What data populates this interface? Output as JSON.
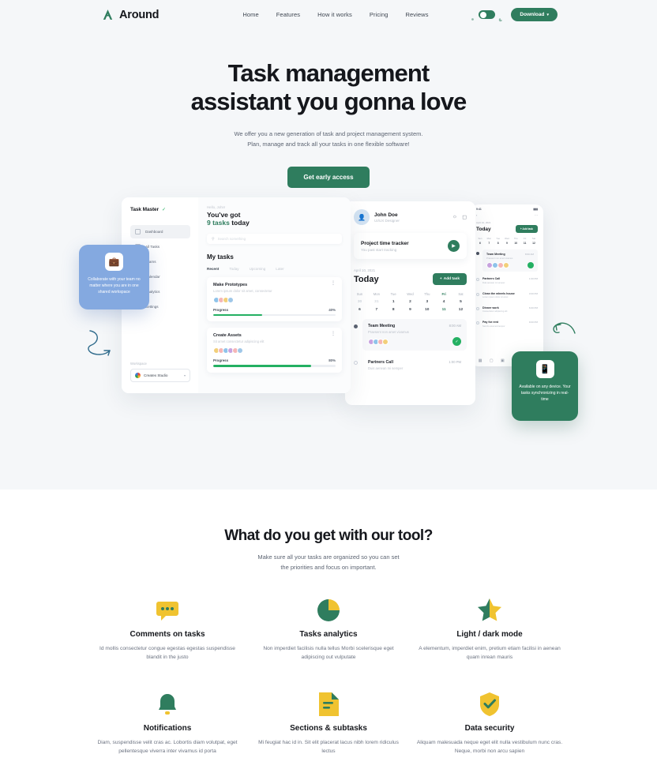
{
  "nav": {
    "logo_text": "Around",
    "links": [
      {
        "label": "Home"
      },
      {
        "label": "Features"
      },
      {
        "label": "How it works"
      },
      {
        "label": "Pricing"
      },
      {
        "label": "Reviews"
      }
    ],
    "download_label": "Download",
    "download_chevron": "▾"
  },
  "hero": {
    "title_line1_highlight": "Task management",
    "title_line2": "assistant you gonna love",
    "sub_line1": "We offer you a new generation of task and project management system.",
    "sub_line2": "Plan, manage and track all your tasks in one flexible software!",
    "cta_label": "Get early access"
  },
  "tips": {
    "blue": "Collaborate with your team no matter where you are in one shared workspace",
    "green": "Available on any device. Your tasks synchronizing in real-time"
  },
  "app": {
    "sidebar": {
      "brand": "Task Master",
      "items": [
        {
          "label": "Dashboard"
        },
        {
          "label": "All Tasks"
        },
        {
          "label": "Teams"
        },
        {
          "label": "Calendar"
        },
        {
          "label": "Analytics"
        },
        {
          "label": "Settings"
        }
      ],
      "workspace_label": "Workspace",
      "workspace_value": "Createx Studio",
      "workspace_chevron": "▾"
    },
    "main": {
      "hello": "Hello, John!",
      "headline_1": "You've got",
      "headline_count": "9 tasks",
      "headline_2": " today",
      "search_placeholder": "Search something",
      "section_title": "My tasks",
      "tabs": [
        "Recent",
        "Today",
        "Upcoming",
        "Later"
      ],
      "tasks": [
        {
          "title": "Make Prototypes",
          "desc": "Lorem ipsum dolor sit amet, consectetur",
          "progress_label": "Progress",
          "progress_value": "40%",
          "progress_pct": 40
        },
        {
          "title": "Create Assets",
          "desc": "Sit amet consectetur adipiscing elit",
          "progress_label": "Progress",
          "progress_value": "80%",
          "progress_pct": 80
        }
      ]
    },
    "detail": {
      "user_name": "John Doe",
      "user_role": "UI/UX Designer",
      "tracker_title": "Project time tracker",
      "tracker_sub": "You past start tracking",
      "date_label": "April 10, 2021",
      "today_label": "Today",
      "add_task_label": "Add task",
      "add_task_plus": "+",
      "weekdays": [
        "Sun",
        "Mon",
        "Tue",
        "Wed",
        "Thu",
        "Fri",
        "Sat"
      ],
      "active_weekday_index": 5,
      "days_row1": [
        "30",
        "31",
        "1",
        "2",
        "3",
        "4",
        "5"
      ],
      "days_row1_dim": [
        true,
        true,
        false,
        false,
        false,
        false,
        false
      ],
      "days_row2": [
        "6",
        "7",
        "8",
        "9",
        "10",
        "11",
        "12"
      ],
      "active_day": "11",
      "events": [
        {
          "title": "Team Meeting",
          "time": "8:00 AM",
          "desc": "Praesent non amet vivamus"
        },
        {
          "title": "Partners Call",
          "time": "1:00 PM",
          "desc": "Duis aenean mi semper"
        }
      ]
    },
    "phone": {
      "status_time": "9:41",
      "status_right": "▮▮▮",
      "back_icon": "‹",
      "menu_icon": "⋯",
      "date_label": "April 10, 2021",
      "today_label": "Today",
      "add_task_label": "+ Add task",
      "weekdays": [
        "Sun",
        "Mon",
        "Tue",
        "Wed",
        "Thu",
        "Fri",
        "Sat"
      ],
      "days": [
        "6",
        "7",
        "8",
        "9",
        "10",
        "11",
        "12"
      ],
      "items": [
        {
          "title": "Team Meeting",
          "time": "8:00 AM",
          "desc": "Praesent non amet vivamus"
        },
        {
          "title": "Partners Call",
          "time": "1:00 PM",
          "desc": "Duis aenean mi semper"
        },
        {
          "title": "Clean the wheels house",
          "time": "3:00 PM",
          "desc": "Lorem ipsum dolor sit amet"
        },
        {
          "title": "Dinner work",
          "time": "6:00 PM",
          "desc": "Consectetur adipiscing elit"
        },
        {
          "title": "Pay for rent",
          "time": "9:00 PM",
          "desc": "Sed do eiusmod tempor"
        }
      ]
    }
  },
  "features": {
    "title": "What do you get with our tool?",
    "sub_line1": "Make sure all your tasks are organized so you can set",
    "sub_line2": "the priorities and focus on important.",
    "items": [
      {
        "icon": "comment-bubble-icon",
        "name": "Comments on tasks",
        "desc": "Id mollis consectetur congue egestas egestas suspendisse blandit in the justo"
      },
      {
        "icon": "pie-chart-icon",
        "name": "Tasks analytics",
        "desc": "Non imperdiet facilisis nulla tellus Morbi scelerisque eget adipiscing out vulputate"
      },
      {
        "icon": "star-icon",
        "name": "Light / dark mode",
        "desc": "A elementum, imperdiet enim, pretium etiam facilisi in aenean quam inrean mauris"
      },
      {
        "icon": "bell-icon",
        "name": "Notifications",
        "desc": "Diam, suspendisse velit cras ac. Lobortis diam volutpat, eget pellentesque viverra inter vivamus id porta"
      },
      {
        "icon": "document-icon",
        "name": "Sections & subtasks",
        "desc": "Mi feugiat hac id in. Sit elit placerat lacus nibh lorem ridiculus lectus"
      },
      {
        "icon": "shield-check-icon",
        "name": "Data security",
        "desc": "Aliquam malesuada neque eget elit nulla vestibulum nunc cras. Neque, morbi non arcu sapien"
      }
    ]
  },
  "colors": {
    "brand_green": "#2f7d5e",
    "accent_yellow": "#f0c330",
    "highlight": "#f6eec2",
    "hero_bg": "#f5f7f9",
    "tip_blue": "#84a9e0"
  }
}
